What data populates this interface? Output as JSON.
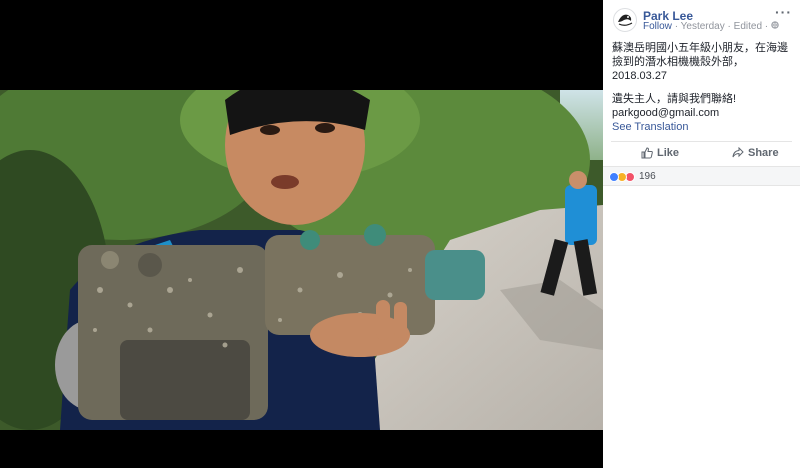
{
  "post": {
    "author": "Park Lee",
    "follow": "Follow",
    "time": "Yesterday",
    "edited": "Edited",
    "sep": "·",
    "more": "···",
    "text_line1": "蘇澳岳明國小五年級小朋友，在海邊撿到的潛水相機機殼外部，2018.03.27",
    "text_line2": "遺失主人，請與我們聯絡!",
    "text_line3": "parkgood@gmail.com",
    "see_translation": "See Translation"
  },
  "actions": {
    "like_label": "Like",
    "share_label": "Share"
  },
  "reactions": {
    "count": "196",
    "types": [
      "like",
      "wow",
      "love"
    ]
  },
  "icons": {
    "like": "thumbs-up-icon",
    "share": "share-arrow-icon",
    "globe": "globe-icon",
    "avatar": "logo-avatar"
  },
  "colors": {
    "link": "#385898",
    "muted": "#90949c",
    "viewer_bg": "#000000",
    "like_reaction": "#4080ff",
    "wow_reaction": "#f7b125",
    "love_reaction": "#f25268"
  }
}
